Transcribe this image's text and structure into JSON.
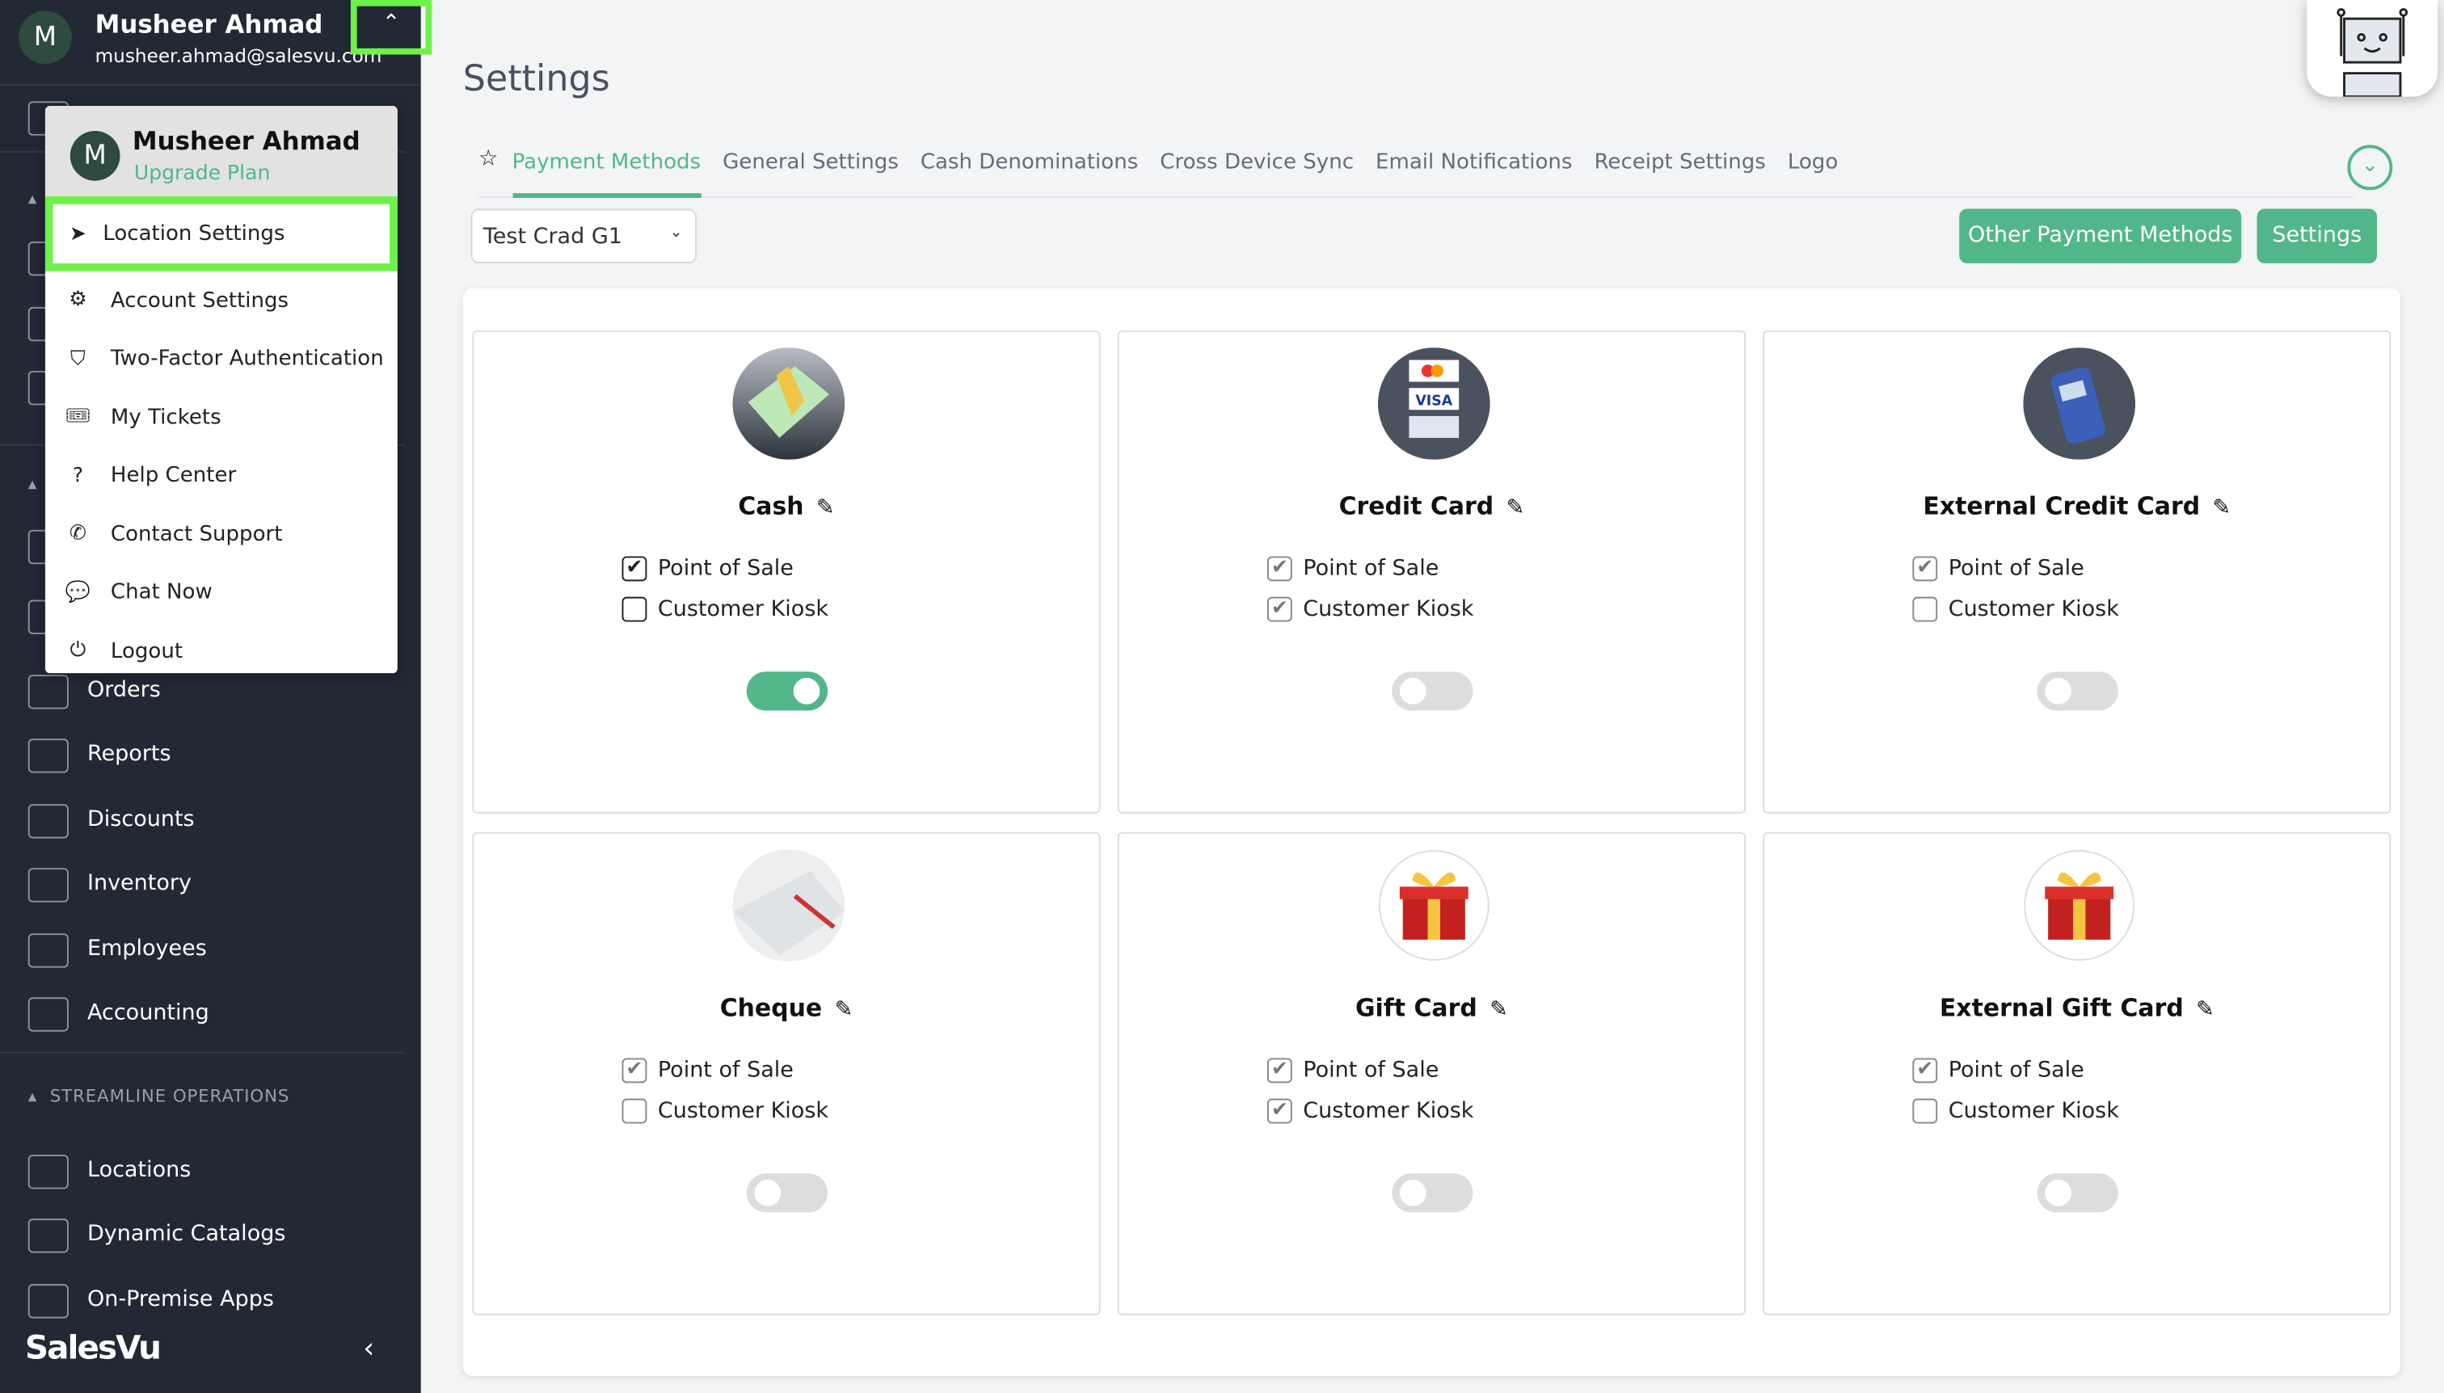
{
  "user": {
    "initial": "M",
    "name": "Musheer Ahmad",
    "email": "musheer.ahmad@salesvu.com",
    "plan_link": "Upgrade Plan"
  },
  "user_menu": [
    {
      "label": "Location Settings",
      "icon": "location-arrow-icon",
      "glyph": "➤",
      "highlighted": true
    },
    {
      "label": "Account Settings",
      "icon": "gear-icon",
      "glyph": "⚙"
    },
    {
      "label": "Two-Factor Authentication",
      "icon": "shield-icon",
      "glyph": "⛉"
    },
    {
      "label": "My Tickets",
      "icon": "ticket-icon",
      "glyph": "🎟"
    },
    {
      "label": "Help Center",
      "icon": "question-circle-icon",
      "glyph": "?"
    },
    {
      "label": "Contact Support",
      "icon": "phone-icon",
      "glyph": "✆"
    },
    {
      "label": "Chat Now",
      "icon": "chat-bubble-icon",
      "glyph": "💬"
    },
    {
      "label": "Logout",
      "icon": "power-icon",
      "glyph": "⏻"
    }
  ],
  "sidebar": {
    "items": [
      {
        "label": "Orders"
      },
      {
        "label": "Reports"
      },
      {
        "label": "Discounts"
      },
      {
        "label": "Inventory"
      },
      {
        "label": "Employees"
      },
      {
        "label": "Accounting"
      }
    ],
    "section2": "STREAMLINE OPERATIONS",
    "items2": [
      {
        "label": "Locations"
      },
      {
        "label": "Dynamic Catalogs"
      },
      {
        "label": "On-Premise Apps"
      }
    ],
    "brand": "SalesVu"
  },
  "page": {
    "title": "Settings"
  },
  "tabs": [
    {
      "label": "Payment Methods",
      "active": true
    },
    {
      "label": "General Settings"
    },
    {
      "label": "Cash Denominations"
    },
    {
      "label": "Cross Device Sync"
    },
    {
      "label": "Email Notifications"
    },
    {
      "label": "Receipt Settings"
    },
    {
      "label": "Logo"
    }
  ],
  "location_select": {
    "value": "Test Crad G1"
  },
  "buttons": {
    "other": "Other Payment Methods",
    "settings": "Settings"
  },
  "colors": {
    "accent": "#52b788",
    "sidebar": "#222834",
    "highlight": "#6ef24a"
  },
  "payment_methods": [
    {
      "name": "Cash",
      "image": "cash-icon",
      "pos": true,
      "kiosk": false,
      "enabled": true,
      "editable_checks": true
    },
    {
      "name": "Credit Card",
      "image": "credit-card-icon",
      "pos": true,
      "kiosk": true,
      "enabled": false
    },
    {
      "name": "External Credit Card",
      "image": "card-terminal-icon",
      "pos": true,
      "kiosk": false,
      "enabled": false
    },
    {
      "name": "Cheque",
      "image": "cheque-icon",
      "pos": true,
      "kiosk": false,
      "enabled": false
    },
    {
      "name": "Gift Card",
      "image": "gift-icon",
      "pos": true,
      "kiosk": true,
      "enabled": false
    },
    {
      "name": "External Gift Card",
      "image": "gift-icon",
      "pos": true,
      "kiosk": false,
      "enabled": false
    }
  ],
  "labels": {
    "pos": "Point of Sale",
    "kiosk": "Customer Kiosk"
  }
}
